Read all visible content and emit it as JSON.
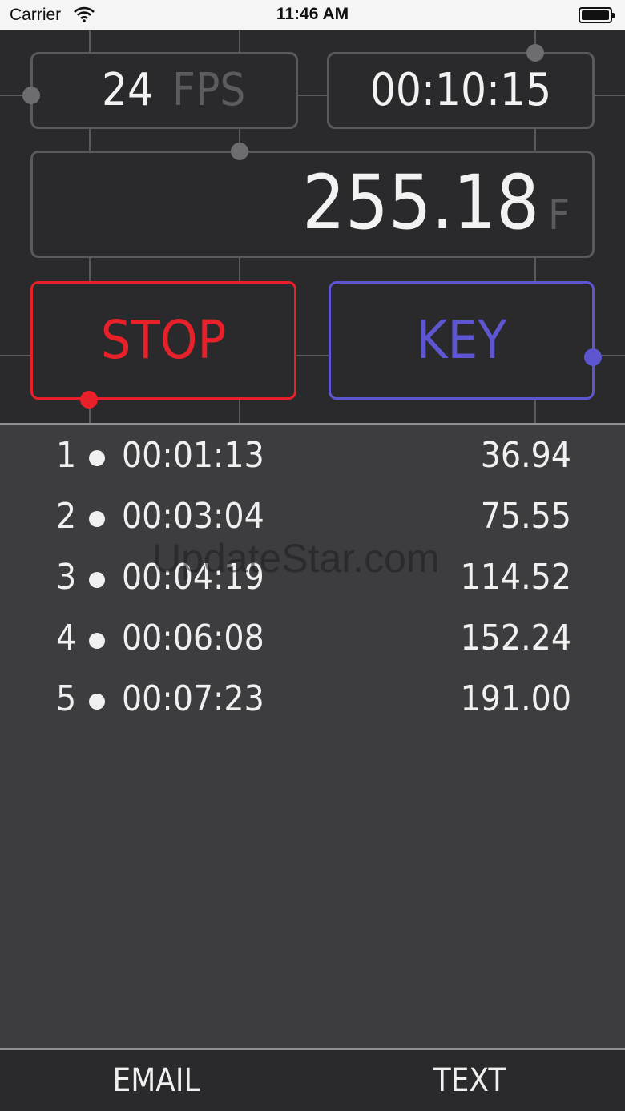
{
  "status_bar": {
    "carrier": "Carrier",
    "time": "11:46 AM"
  },
  "fps": {
    "value": "24",
    "unit": "FPS"
  },
  "timecode": {
    "value": "00:10:15"
  },
  "frames": {
    "value": "255.18",
    "unit": "F"
  },
  "buttons": {
    "stop": "STOP",
    "key": "KEY"
  },
  "marks": [
    {
      "index": "1",
      "time": "00:01:13",
      "frames": "36.94"
    },
    {
      "index": "2",
      "time": "00:03:04",
      "frames": "75.55"
    },
    {
      "index": "3",
      "time": "00:04:19",
      "frames": "114.52"
    },
    {
      "index": "4",
      "time": "00:06:08",
      "frames": "152.24"
    },
    {
      "index": "5",
      "time": "00:07:23",
      "frames": "191.00"
    }
  ],
  "watermark": "UpdateStar.com",
  "footer": {
    "email": "EMAIL",
    "text": "TEXT"
  },
  "colors": {
    "stop": "#e8202a",
    "key": "#5e55d0",
    "panel": "#2a2a2c",
    "list_bg": "#3d3d3f"
  },
  "icons": {
    "wifi": "wifi-icon",
    "battery": "battery-icon"
  }
}
